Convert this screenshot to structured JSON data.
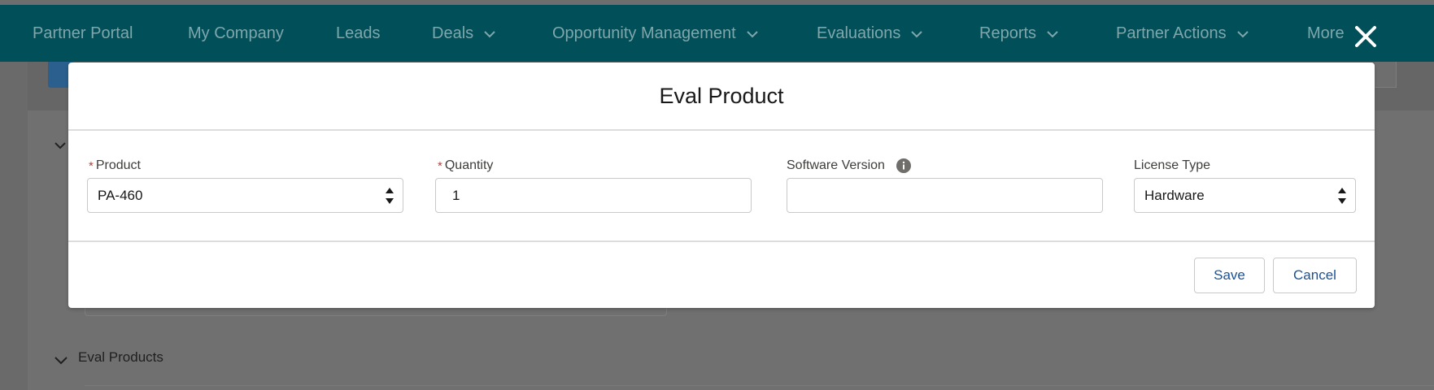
{
  "nav": {
    "items": [
      {
        "label": "Partner Portal",
        "dropdown": false
      },
      {
        "label": "My Company",
        "dropdown": false
      },
      {
        "label": "Leads",
        "dropdown": false
      },
      {
        "label": "Deals",
        "dropdown": true
      },
      {
        "label": "Opportunity Management",
        "dropdown": true
      },
      {
        "label": "Evaluations",
        "dropdown": true
      },
      {
        "label": "Reports",
        "dropdown": true
      },
      {
        "label": "Partner Actions",
        "dropdown": true
      },
      {
        "label": "More",
        "dropdown": false
      }
    ],
    "close_icon": "close-icon"
  },
  "background": {
    "section_label": "Eval Products"
  },
  "modal": {
    "title": "Eval Product",
    "fields": {
      "product": {
        "label": "Product",
        "required": true,
        "value": "PA-460"
      },
      "quantity": {
        "label": "Quantity",
        "required": true,
        "value": "1"
      },
      "software_version": {
        "label": "Software Version",
        "required": false,
        "value": "",
        "icon": "info-icon"
      },
      "license_type": {
        "label": "License Type",
        "required": false,
        "value": "Hardware"
      }
    },
    "save_label": "Save",
    "cancel_label": "Cancel"
  },
  "colors": {
    "nav_bg": "#014f59",
    "nav_text": "#7fa7ab",
    "required": "#c23934",
    "button_text": "#1b5297"
  }
}
